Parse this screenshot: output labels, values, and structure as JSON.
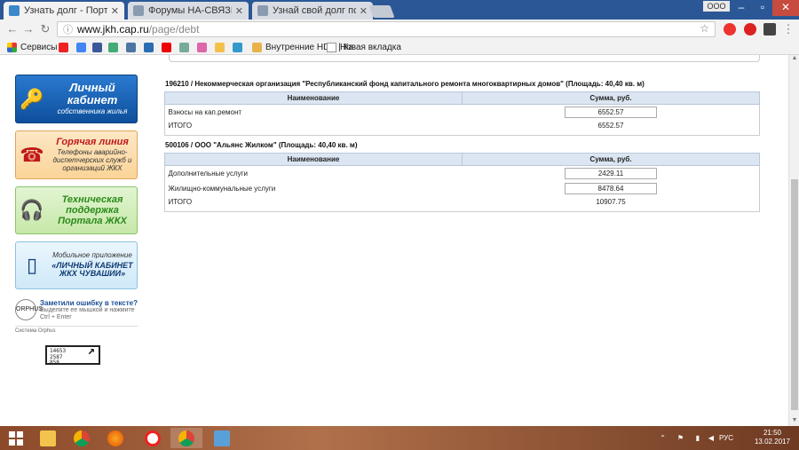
{
  "browser": {
    "tabs": [
      {
        "title": "Узнать долг - Портал ЖК",
        "active": true
      },
      {
        "title": "Форумы НА-СВЯЗИ -> Р",
        "active": false
      },
      {
        "title": "Узнай свой долг по кап",
        "active": false
      }
    ],
    "user_badge": "ООО",
    "url_host": "www.jkh.cap.ru",
    "url_path": "/page/debt",
    "bookmarks": [
      {
        "label": "Сервисы"
      },
      {
        "label": "Внутренние HDD | Ка"
      },
      {
        "label": "Новая вкладка"
      }
    ]
  },
  "sidebar": {
    "cabinet": {
      "title": "Личный кабинет",
      "sub": "собственника жилья"
    },
    "hotline": {
      "title": "Горячая линия",
      "sub": "Телефоны аварийно-диспетчерских служб и организаций ЖКХ"
    },
    "support": {
      "title": "Техническая поддержка Портала ЖКХ"
    },
    "mobile": {
      "sub": "Мобильное приложение",
      "title": "«ЛИЧНЫЙ КАБИНЕТ ЖКХ ЧУВАШИИ»"
    },
    "orphus": {
      "title": "Заметили ошибку в тексте?",
      "hint": "Выделите ее мышкой и нажмите Ctrl + Enter",
      "system": "Система Orphus",
      "icon_label": "ORPHUS"
    },
    "counter": {
      "line1": "14653",
      "line2": "2587",
      "line3": "858"
    }
  },
  "sections": [
    {
      "title": "196210 / Некоммерческая организация \"Республиканский фонд капитального ремонта многоквартирных домов\" (Площадь: 40,40 кв. м)",
      "col_name": "Наименование",
      "col_sum": "Сумма, руб.",
      "rows": [
        {
          "name": "Взносы на кап.ремонт",
          "sum": "6552.57"
        }
      ],
      "total_label": "ИТОГО",
      "total_sum": "6552.57"
    },
    {
      "title": "500106 / ООО \"Альянс Жилком\" (Площадь: 40,40 кв. м)",
      "col_name": "Наименование",
      "col_sum": "Сумма, руб.",
      "rows": [
        {
          "name": "Дополнительные услуги",
          "sum": "2429.11"
        },
        {
          "name": "Жилищно-коммунальные услуги",
          "sum": "8478.64"
        }
      ],
      "total_label": "ИТОГО",
      "total_sum": "10907.75"
    }
  ],
  "taskbar": {
    "lang": "РУС",
    "time": "21:50",
    "date": "13.02.2017"
  },
  "colors": {
    "titlebar": "#2b5797",
    "table_header": "#dce6f2",
    "cabinet_blue": "#0e4f9c",
    "hotline_red": "#c0181b",
    "support_green": "#2c8a1b"
  }
}
